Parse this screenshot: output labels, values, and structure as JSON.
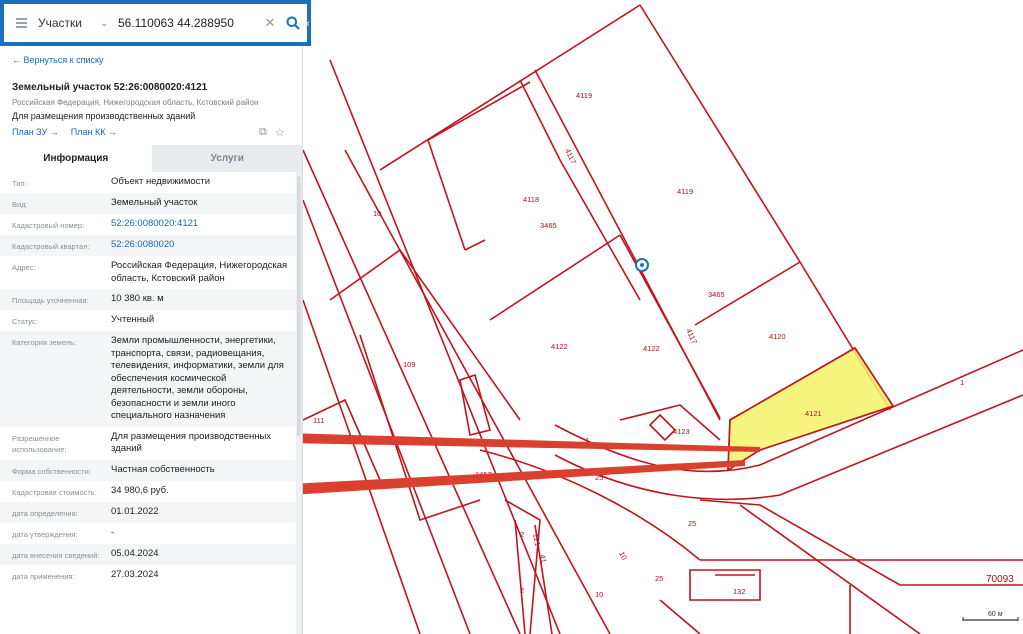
{
  "search": {
    "layer": "Участки",
    "query": "56.110063 44.288950"
  },
  "panel": {
    "back_link": "← Вернуться к списку",
    "title": "Земельный участок 52:26:0080020:4121",
    "address_line": "Российская Федерация, Нижегородская область, Кстовский район",
    "use_line": "Для размещения производственных зданий",
    "plan_zu": "План ЗУ →",
    "plan_kk": "План КК →",
    "tabs": [
      "Информация",
      "Услуги"
    ],
    "rows": [
      {
        "label": "Тип:",
        "value": "Объект недвижимости"
      },
      {
        "label": "Вид:",
        "value": "Земельный участок"
      },
      {
        "label": "Кадастровый номер:",
        "value": "52:26:0080020:4121",
        "link": true
      },
      {
        "label": "Кадастровый квартал:",
        "value": "52:26:0080020",
        "link": true
      },
      {
        "label": "Адрес:",
        "value": "Российская Федерация, Нижегородская область, Кстовский район"
      },
      {
        "label": "Площадь уточненная:",
        "value": "10 380 кв. м"
      },
      {
        "label": "Статус:",
        "value": "Учтенный"
      },
      {
        "label": "Категория земель:",
        "value": "Земли промышленности, энергетики, транспорта, связи, радиовещания, телевидения, информатики, земли для обеспечения космической деятельности, земли обороны, безопасности и земли иного специального назначения"
      },
      {
        "label": "Разрешенное использование:",
        "value": "Для размещения производственных зданий"
      },
      {
        "label": "Форма собственности:",
        "value": "Частная собственность"
      },
      {
        "label": "Кадастровая стоимость:",
        "value": "34 980,6 руб."
      },
      {
        "label": "дата определения:",
        "value": "01.01.2022"
      },
      {
        "label": "дата утверждения:",
        "value": "-"
      },
      {
        "label": "дата внесения сведений:",
        "value": "05.04.2024"
      },
      {
        "label": "дата применения:",
        "value": "27.03.2024"
      }
    ]
  },
  "map": {
    "parcel_labels": [
      "4119",
      "4117",
      "4119",
      "4118",
      "3465",
      "3465",
      "4117",
      "4120",
      "4122",
      "4122",
      "4121",
      "4123",
      "10",
      "109",
      "111",
      "1",
      "1457",
      "25",
      "25",
      "1",
      "121",
      "41",
      "2",
      "10",
      "10",
      "25",
      "132",
      "2",
      "70093"
    ],
    "scale_label": "60 м",
    "colors": {
      "boundary": "#c0141e",
      "highlight": "#f7f26a",
      "arrow": "#d9412e",
      "accent": "#1c6fbd"
    }
  },
  "icons": [
    "menu-icon",
    "chevron-down-icon",
    "clear-icon",
    "search-icon",
    "collapse-icon",
    "copy-icon",
    "star-icon",
    "location-marker-icon"
  ]
}
